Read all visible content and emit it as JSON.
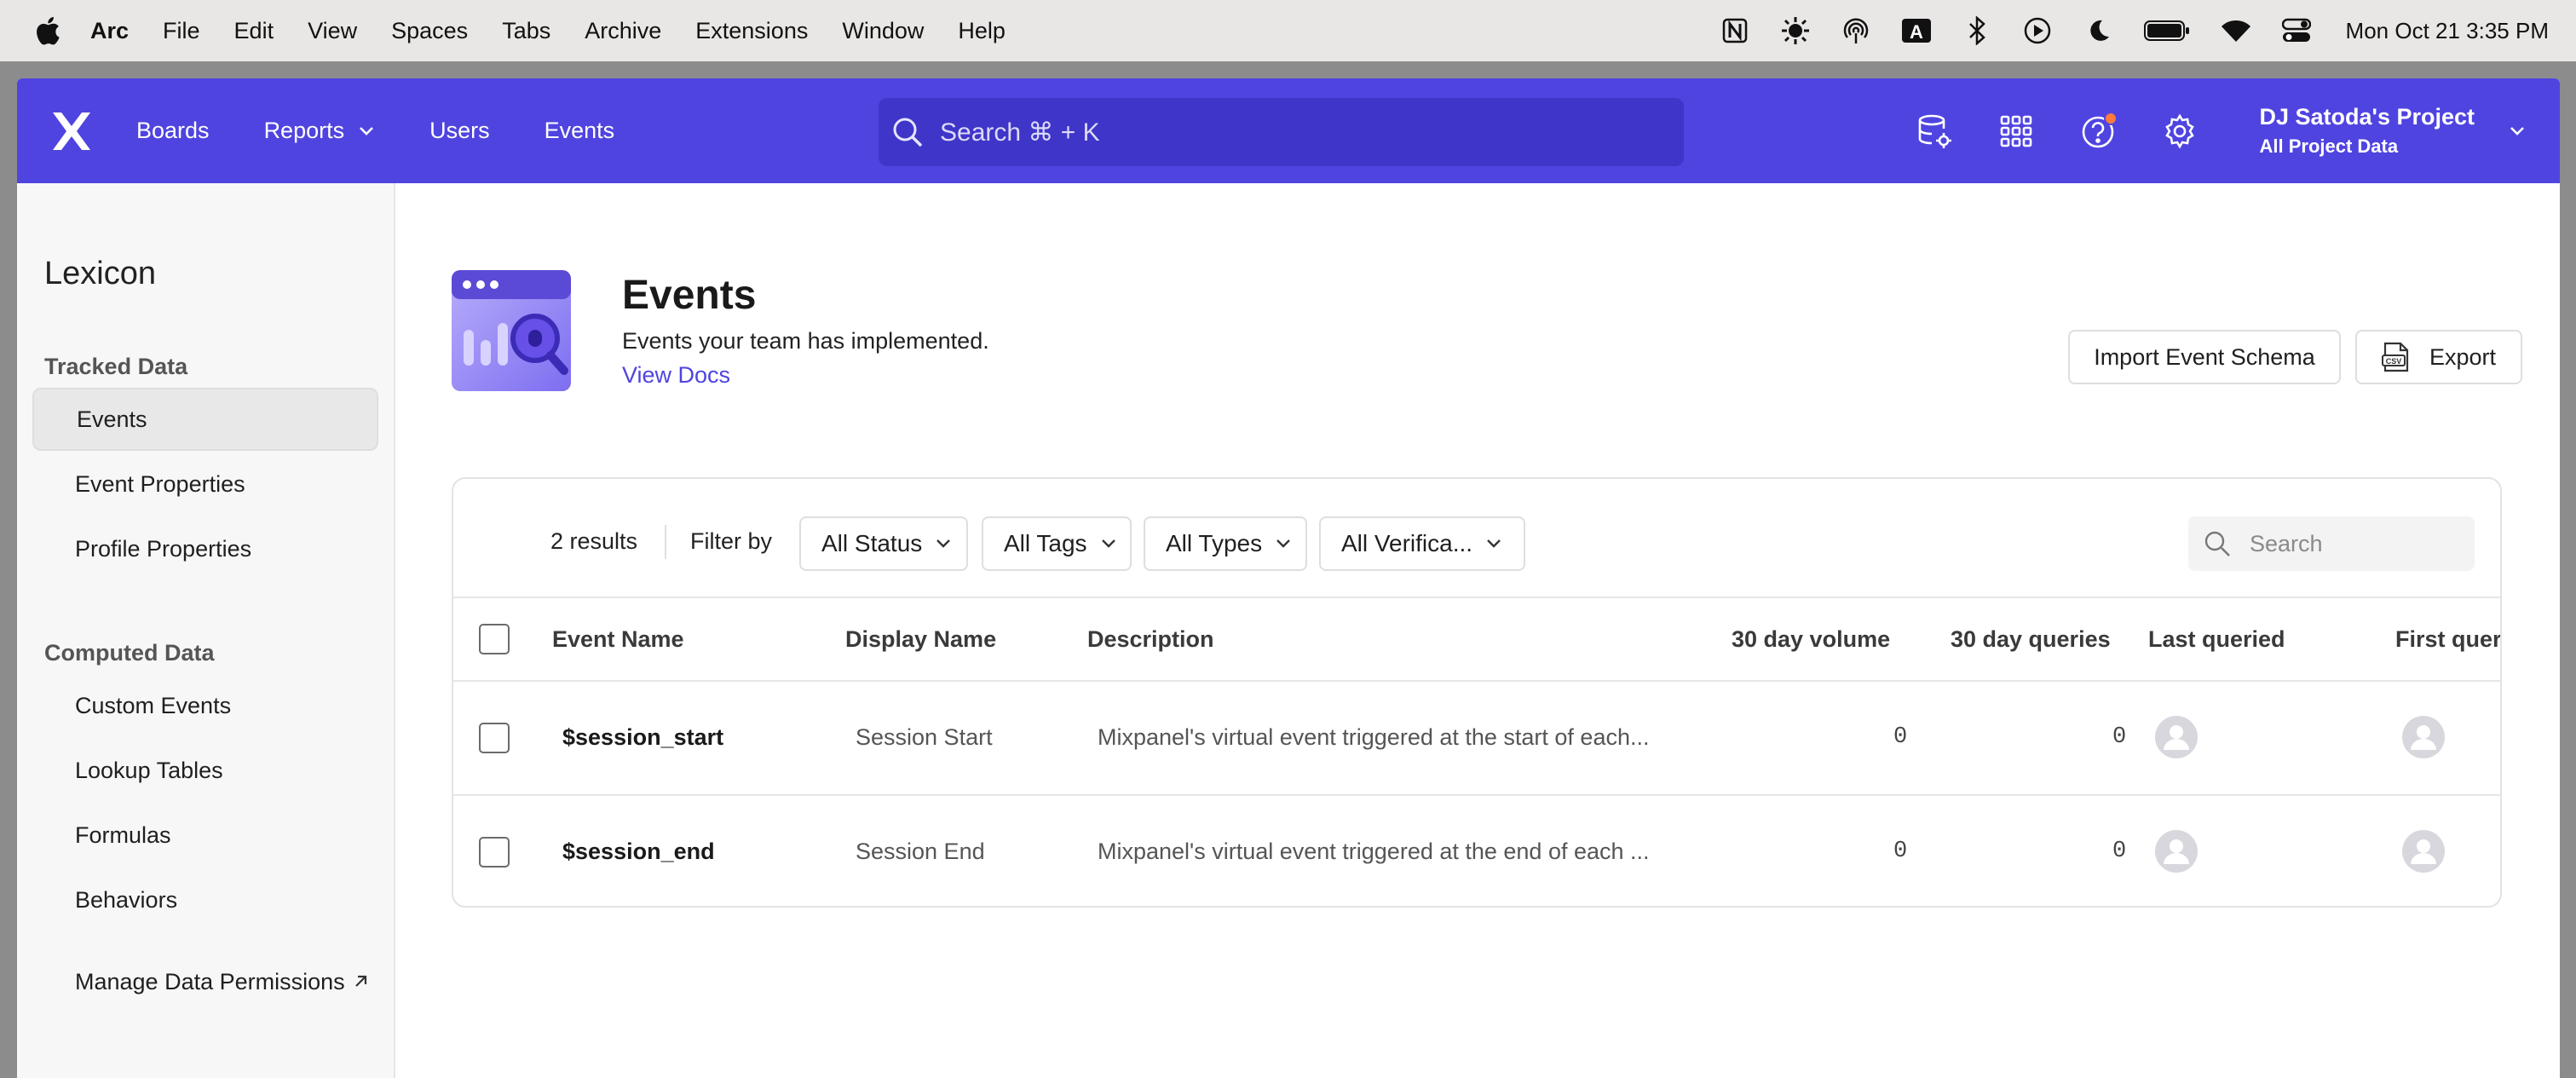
{
  "menubar": {
    "app": "Arc",
    "items": [
      "File",
      "Edit",
      "View",
      "Spaces",
      "Tabs",
      "Archive",
      "Extensions",
      "Window",
      "Help"
    ],
    "clock": "Mon Oct 21  3:35 PM"
  },
  "nav": {
    "boards": "Boards",
    "reports": "Reports",
    "users": "Users",
    "events": "Events",
    "search": "Search  ⌘ + K",
    "project_name": "DJ Satoda's Project",
    "project_sub": "All Project Data"
  },
  "sidebar": {
    "title": "Lexicon",
    "tracked_section": "Tracked Data",
    "tracked_items": [
      "Events",
      "Event Properties",
      "Profile Properties"
    ],
    "computed_section": "Computed Data",
    "computed_items": [
      "Custom Events",
      "Lookup Tables",
      "Formulas",
      "Behaviors"
    ],
    "manage": "Manage Data Permissions"
  },
  "page": {
    "title": "Events",
    "subtitle": "Events your team has implemented.",
    "docs_link": "View Docs",
    "import_button": "Import Event Schema",
    "export_button": "Export"
  },
  "filters": {
    "results": "2 results",
    "filter_by": "Filter by",
    "status": "All Status",
    "tags": "All Tags",
    "types": "All Types",
    "verification": "All Verifica...",
    "search_placeholder": "Search"
  },
  "table": {
    "columns": [
      "Event Name",
      "Display Name",
      "Description",
      "30 day volume",
      "30 day queries",
      "Last queried",
      "First queri"
    ],
    "rows": [
      {
        "name": "$session_start",
        "display": "Session Start",
        "description": "Mixpanel's virtual event triggered at the start of each...",
        "volume": "0",
        "queries": "0"
      },
      {
        "name": "$session_end",
        "display": "Session End",
        "description": "Mixpanel's virtual event triggered at the end of each ...",
        "volume": "0",
        "queries": "0"
      }
    ]
  },
  "colors": {
    "brand": "#4f44e0",
    "notification": "#ff7a3d"
  }
}
